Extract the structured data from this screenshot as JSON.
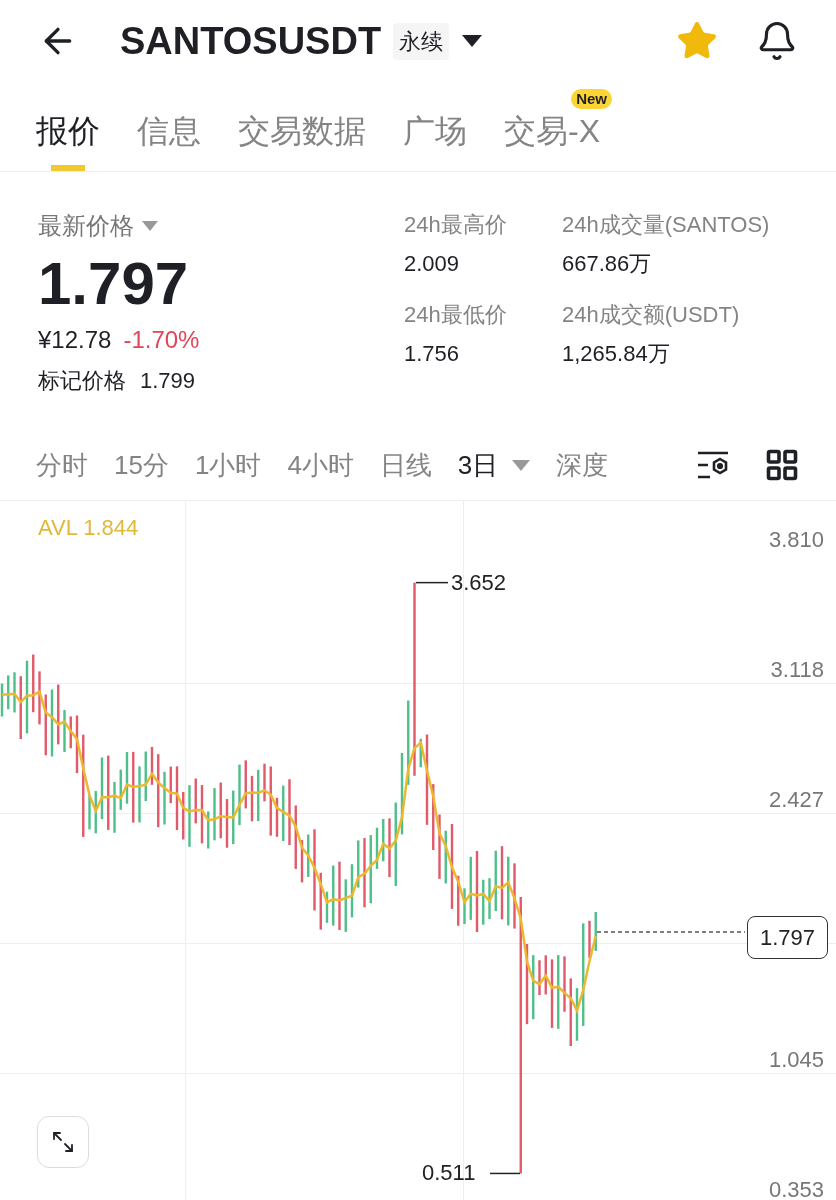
{
  "header": {
    "symbol": "SANTOSUSDT",
    "contract_badge": "永续",
    "favorite": true
  },
  "tabs": [
    {
      "label": "报价",
      "selected": true
    },
    {
      "label": "信息",
      "selected": false
    },
    {
      "label": "交易数据",
      "selected": false
    },
    {
      "label": "广场",
      "selected": false
    },
    {
      "label": "交易-X",
      "selected": false,
      "badge": "New"
    }
  ],
  "price": {
    "label": "最新价格",
    "last": "1.797",
    "cny": "¥12.78",
    "change": "-1.70%",
    "mark_label": "标记价格",
    "mark": "1.799"
  },
  "stats": [
    {
      "label": "24h最高价",
      "value": "2.009"
    },
    {
      "label": "24h成交量(SANTOS)",
      "value": "667.86万"
    },
    {
      "label": "24h最低价",
      "value": "1.756"
    },
    {
      "label": "24h成交额(USDT)",
      "value": "1,265.84万"
    }
  ],
  "intervals": [
    {
      "label": "分时",
      "selected": false
    },
    {
      "label": "15分",
      "selected": false
    },
    {
      "label": "1小时",
      "selected": false
    },
    {
      "label": "4小时",
      "selected": false
    },
    {
      "label": "日线",
      "selected": false
    },
    {
      "label": "3日",
      "selected": true,
      "dropdown": true
    },
    {
      "label": "深度",
      "selected": false
    }
  ],
  "chart": {
    "avl": "AVL 1.844",
    "axis_labels": [
      "3.810",
      "3.118",
      "2.427",
      "1.045",
      "0.353"
    ],
    "high_marker": "3.652",
    "low_marker": "0.511",
    "last_price_tag": "1.797"
  }
}
